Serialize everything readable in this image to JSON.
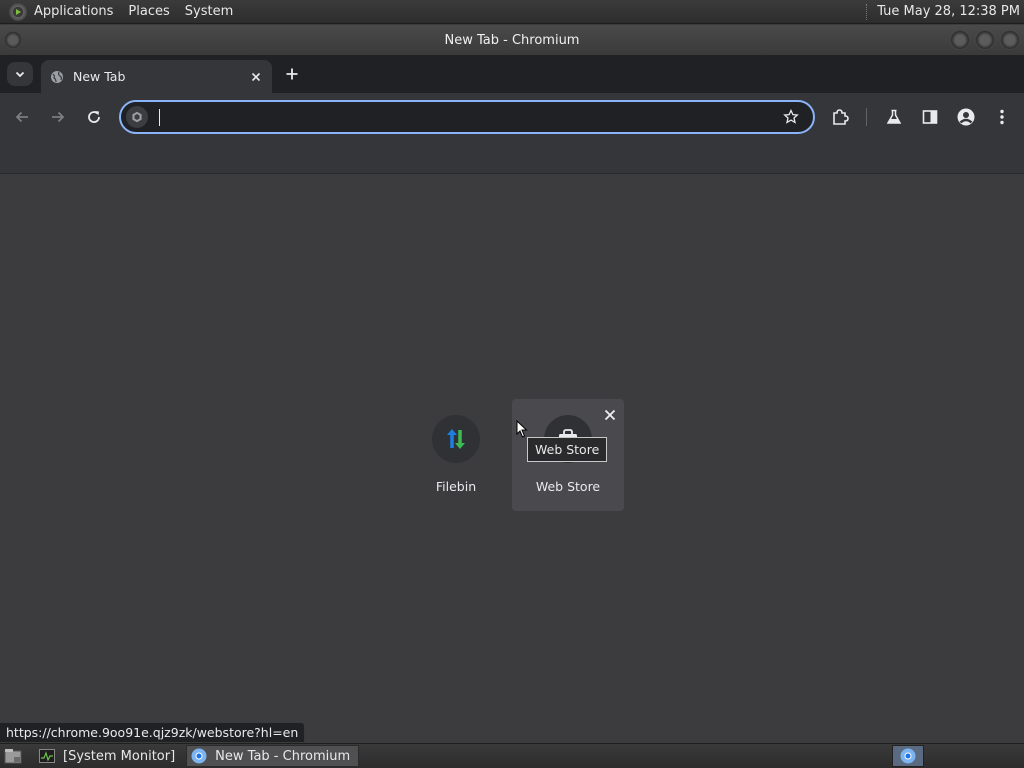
{
  "top_panel": {
    "menus": [
      "Applications",
      "Places",
      "System"
    ],
    "clock": "Tue May 28, 12:38 PM"
  },
  "window": {
    "title": "New Tab - Chromium"
  },
  "tabs": [
    {
      "label": "New Tab",
      "icon": "globe-icon",
      "active": true
    }
  ],
  "toolbar": {
    "omnibox_value": "",
    "omnibox_placeholder": ""
  },
  "shortcuts": [
    {
      "label": "Filebin",
      "icon": "filebin-icon"
    },
    {
      "label": "Web Store",
      "icon": "web-store-icon",
      "hovered": true
    }
  ],
  "tooltip": "Web Store",
  "status_url": "https://chrome.9oo91e.qjz9zk/webstore?hl=en",
  "taskbar": {
    "tasks": [
      {
        "label": "[System Monitor]",
        "icon": "system-monitor-icon",
        "active": false
      },
      {
        "label": "New Tab - Chromium",
        "icon": "chromium-icon",
        "active": true
      }
    ]
  },
  "colors": {
    "accent": "#8ab4f8",
    "page_background": "#3c3c3f",
    "toolbar": "#35363a",
    "tabstrip": "#202124"
  }
}
